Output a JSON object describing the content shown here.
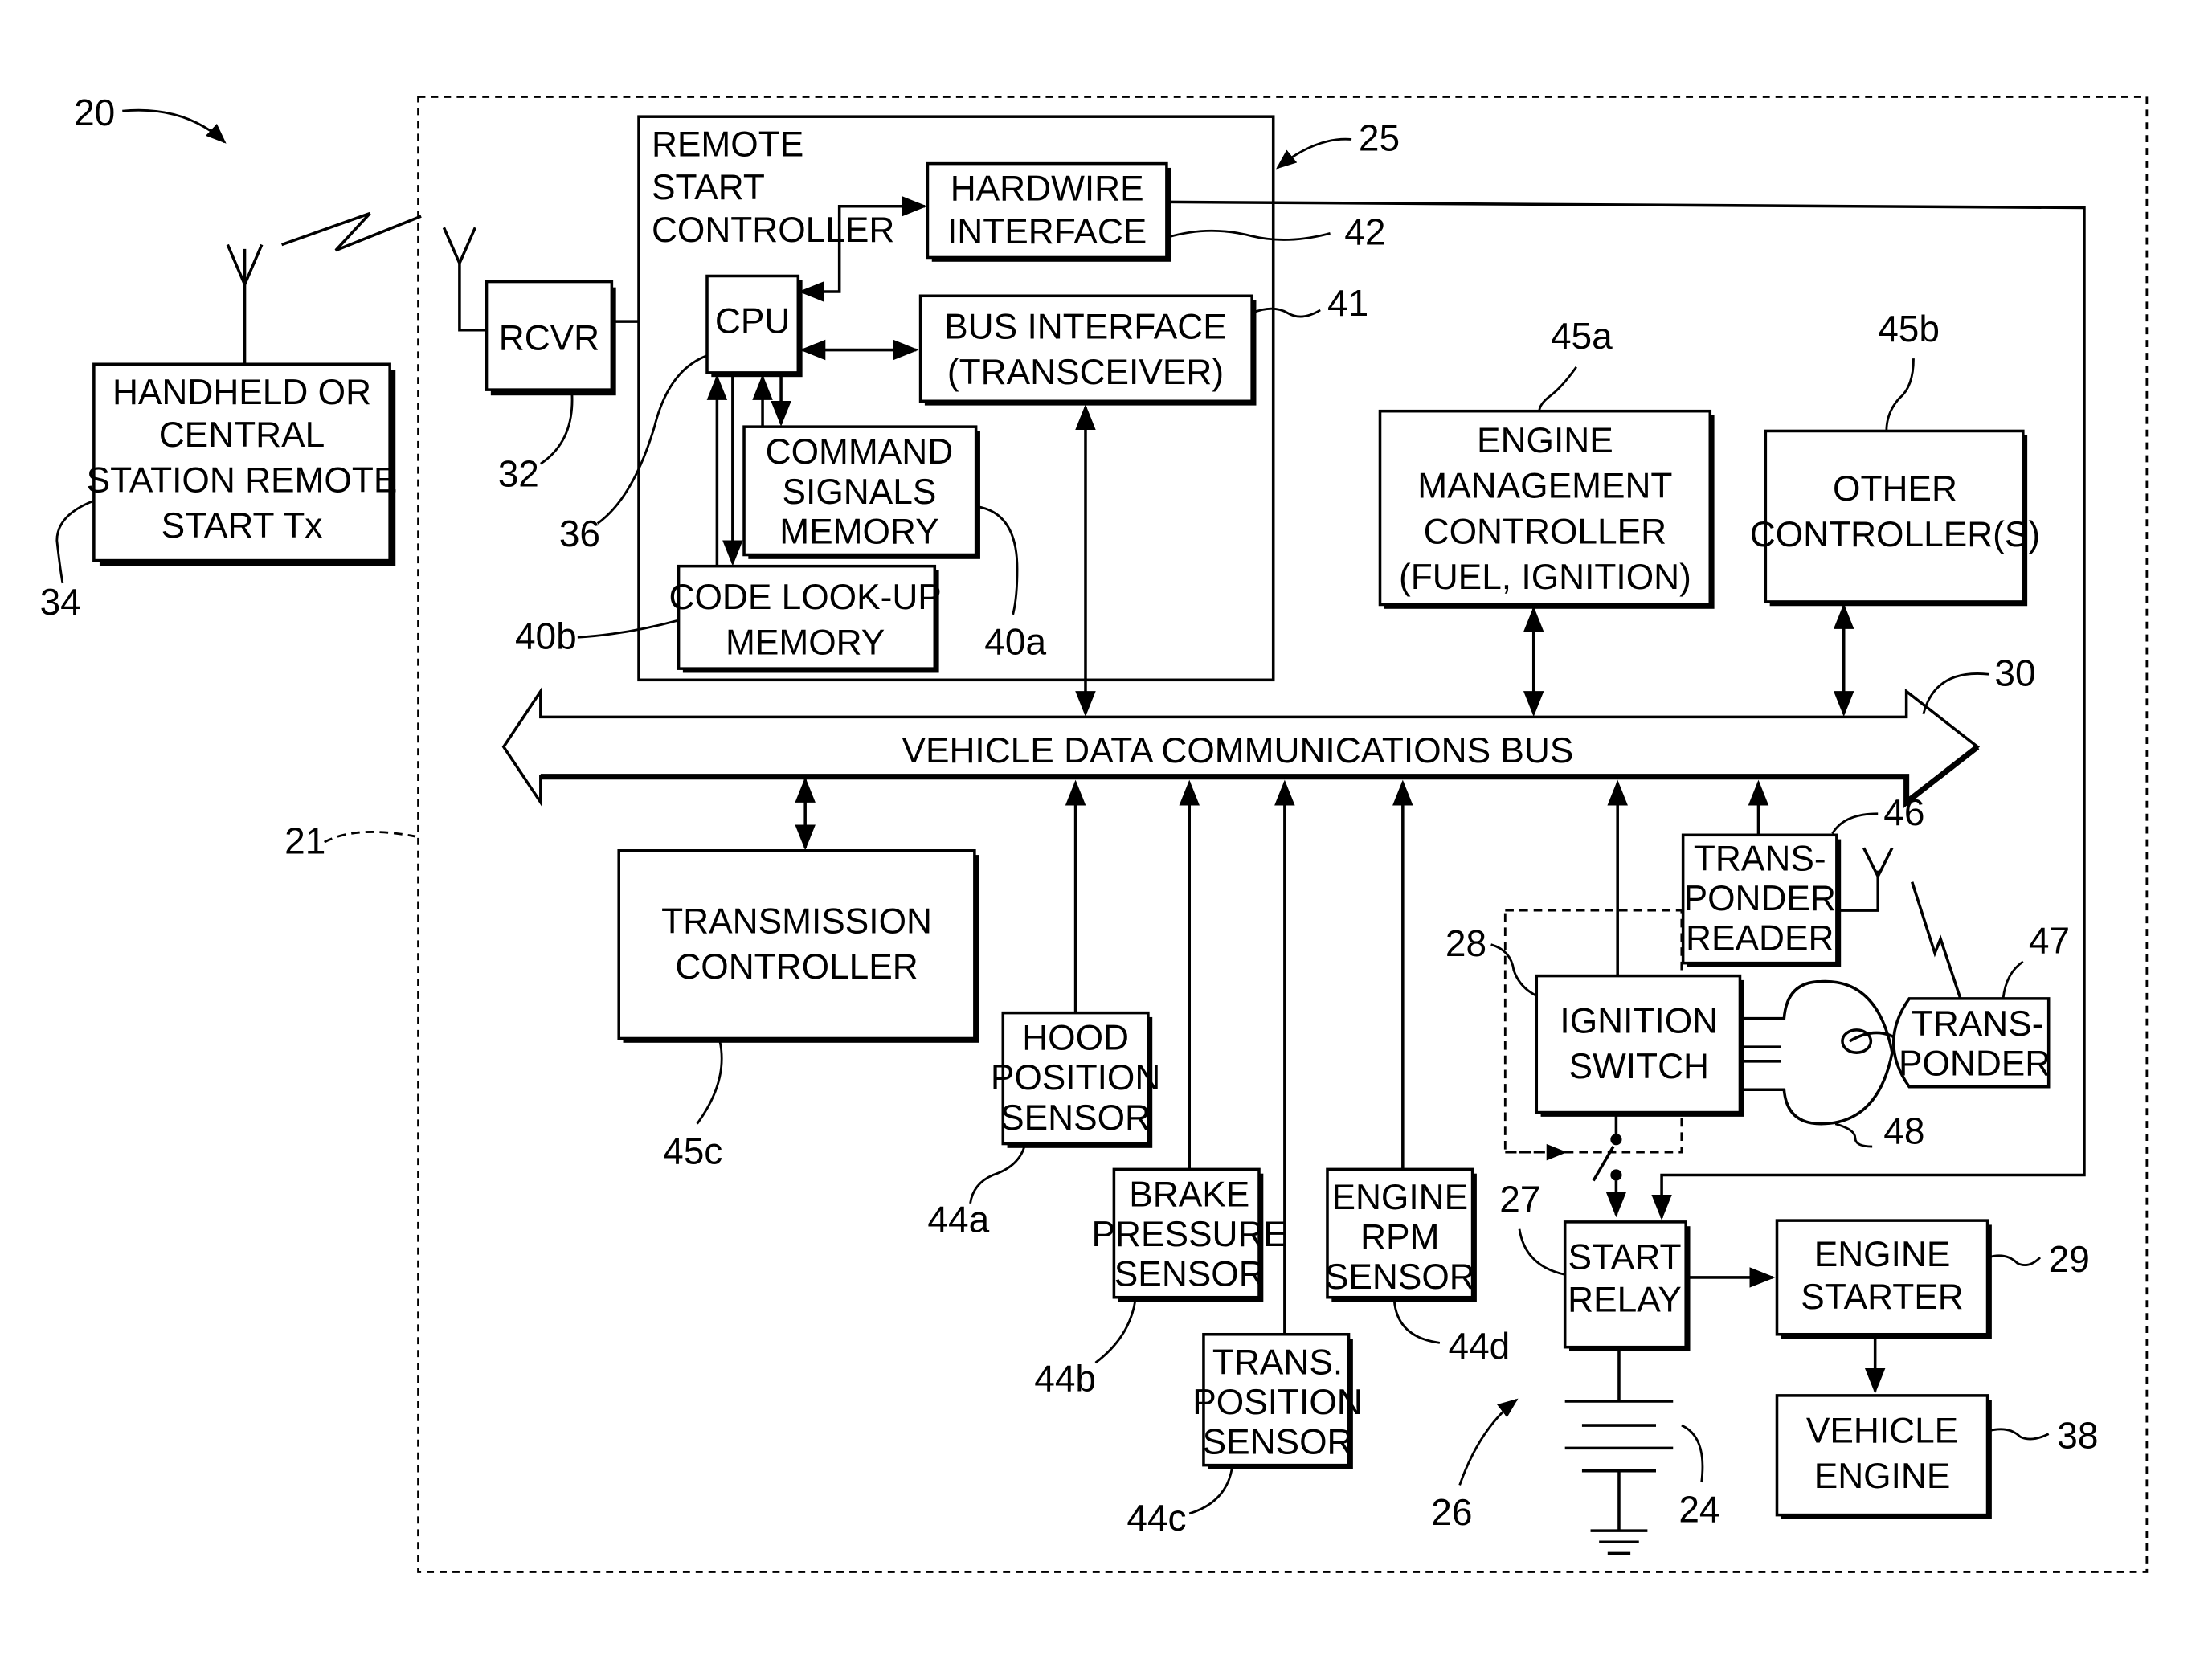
{
  "figure": {
    "ref_system": "20",
    "ref_vehicle_boundary": "21",
    "ref_remote_controller": "25",
    "ref_bus": "30"
  },
  "remote_start_controller": {
    "title_lines": [
      "REMOTE",
      "START",
      "CONTROLLER"
    ],
    "ref": "25"
  },
  "blocks": {
    "handheld_tx": {
      "lines": [
        "HANDHELD OR",
        "CENTRAL",
        "STATION REMOTE",
        "START Tx"
      ],
      "ref": "34"
    },
    "rcvr": {
      "lines": [
        "RCVR"
      ],
      "ref": "32"
    },
    "cpu": {
      "lines": [
        "CPU"
      ],
      "ref": "36"
    },
    "hardwire_interface": {
      "lines": [
        "HARDWIRE",
        "INTERFACE"
      ],
      "ref": "42"
    },
    "bus_interface": {
      "lines": [
        "BUS INTERFACE",
        "(TRANSCEIVER)"
      ],
      "ref": "41"
    },
    "command_signals_memory": {
      "lines": [
        "COMMAND",
        "SIGNALS",
        "MEMORY"
      ],
      "ref": "40a"
    },
    "code_lookup_memory": {
      "lines": [
        "CODE LOOK-UP",
        "MEMORY"
      ],
      "ref": "40b"
    },
    "engine_management": {
      "lines": [
        "ENGINE",
        "MANAGEMENT",
        "CONTROLLER",
        "(FUEL, IGNITION)"
      ],
      "ref": "45a"
    },
    "other_controllers": {
      "lines": [
        "OTHER",
        "CONTROLLER(S)"
      ],
      "ref": "45b"
    },
    "transmission_controller": {
      "lines": [
        "TRANSMISSION",
        "CONTROLLER"
      ],
      "ref": "45c"
    },
    "hood_sensor": {
      "lines": [
        "HOOD",
        "POSITION",
        "SENSOR"
      ],
      "ref": "44a"
    },
    "brake_sensor": {
      "lines": [
        "BRAKE",
        "PRESSURE",
        "SENSOR"
      ],
      "ref": "44b"
    },
    "trans_position_sensor": {
      "lines": [
        "TRANS.",
        "POSITION",
        "SENSOR"
      ],
      "ref": "44c"
    },
    "engine_rpm_sensor": {
      "lines": [
        "ENGINE",
        "RPM",
        "SENSOR"
      ],
      "ref": "44d"
    },
    "transponder_reader": {
      "lines": [
        "TRANS-",
        "PONDER",
        "READER"
      ],
      "ref": "46"
    },
    "transponder": {
      "lines": [
        "TRANS-",
        "PONDER"
      ],
      "ref": "47"
    },
    "ignition_switch": {
      "lines": [
        "IGNITION",
        "SWITCH"
      ],
      "ref": "28"
    },
    "start_relay": {
      "lines": [
        "START",
        "RELAY"
      ],
      "ref": "27"
    },
    "engine_starter": {
      "lines": [
        "ENGINE",
        "STARTER"
      ],
      "ref": "29"
    },
    "vehicle_engine": {
      "lines": [
        "VEHICLE",
        "ENGINE"
      ],
      "ref": "38"
    }
  },
  "bus": {
    "label": "VEHICLE DATA COMMUNICATIONS BUS",
    "ref": "30"
  },
  "other_refs": {
    "key": "48",
    "battery": "24",
    "start_circuit": "26"
  }
}
